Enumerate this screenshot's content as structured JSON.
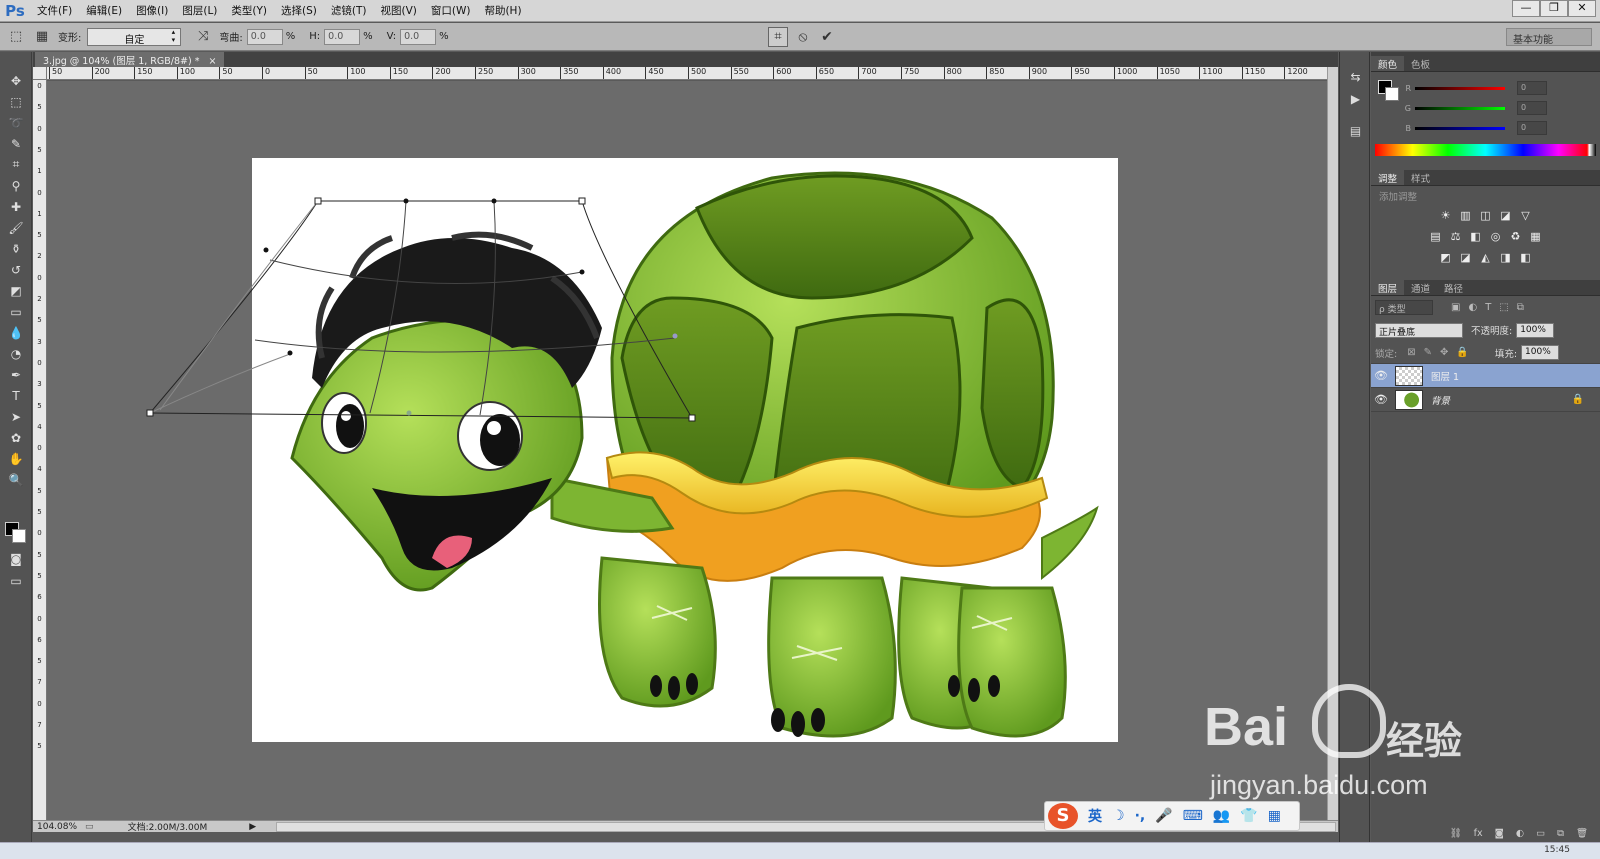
{
  "app": {
    "logo": "Ps"
  },
  "menu": [
    "文件(F)",
    "编辑(E)",
    "图像(I)",
    "图层(L)",
    "类型(Y)",
    "选择(S)",
    "滤镜(T)",
    "视图(V)",
    "窗口(W)",
    "帮助(H)"
  ],
  "window_controls": [
    "—",
    "❐",
    "✕"
  ],
  "options": {
    "warp_label": "变形:",
    "warp_value": "自定",
    "bend_label": "弯曲:",
    "bend_value": "0.0",
    "pct1": "%",
    "h_label": "H:",
    "h_value": "0.0",
    "pct2": "%",
    "v_label": "V:",
    "v_value": "0.0",
    "pct3": "%",
    "workspace": "基本功能"
  },
  "document": {
    "tab_title": "3.jpg @ 104% (图层 1, RGB/8#) *",
    "tab_close": "×",
    "zoom": "104.08%",
    "doc_size": "文档:2.00M/3.00M"
  },
  "ruler_top": [
    "50",
    "200",
    "150",
    "100",
    "50",
    "0",
    "50",
    "100",
    "150",
    "200",
    "250",
    "300",
    "350",
    "400",
    "450",
    "500",
    "550",
    "600",
    "650",
    "700",
    "750",
    "800",
    "850",
    "900",
    "950",
    "1000",
    "1050",
    "1100",
    "1150",
    "1200"
  ],
  "ruler_left": [
    "0",
    "5",
    "0",
    "5",
    "1",
    "0",
    "1",
    "5",
    "2",
    "0",
    "2",
    "5",
    "3",
    "0",
    "3",
    "5",
    "4",
    "0",
    "4",
    "5",
    "5",
    "0",
    "5",
    "5",
    "6",
    "0",
    "6",
    "5",
    "7",
    "0",
    "7",
    "5"
  ],
  "color_panel": {
    "tabs": [
      "颜色",
      "色板"
    ],
    "r_label": "R",
    "g_label": "G",
    "b_label": "B",
    "r_value": "0",
    "g_value": "0",
    "b_value": "0"
  },
  "adjustments_panel": {
    "tabs": [
      "调整",
      "样式"
    ],
    "heading": "添加调整",
    "icons_row1": [
      "☀",
      "▥",
      "◫",
      "◪",
      "▽"
    ],
    "icons_row2": [
      "▤",
      "⚖",
      "◧",
      "◎",
      "♻",
      "▦"
    ],
    "icons_row3": [
      "◩",
      "◪",
      "◭",
      "◨",
      "◧"
    ]
  },
  "layers_panel": {
    "tabs": [
      "图层",
      "通道",
      "路径"
    ],
    "filter_label": "ρ 类型",
    "blend_mode": "正片叠底",
    "opacity_label": "不透明度:",
    "opacity_value": "100%",
    "lock_label": "锁定:",
    "fill_label": "填充:",
    "fill_value": "100%",
    "layers": [
      {
        "name": "图层 1",
        "selected": true
      },
      {
        "name": "背景",
        "selected": false,
        "locked": true
      }
    ]
  },
  "ime": {
    "logo": "S",
    "mode": "英",
    "items": [
      "☽",
      "·,",
      "🎤",
      "⌨",
      "👥",
      "👕",
      "▦"
    ]
  },
  "watermark": {
    "brand": "Bai",
    "jingyan": "经验",
    "url": "jingyan.baidu.com"
  },
  "taskbar": {
    "clock": "15:45"
  },
  "colors": {
    "accent": "#2d6cc0",
    "shell_green": "#5d8a1c",
    "body_green": "#8cc63f",
    "band_yellow": "#f5e040"
  }
}
